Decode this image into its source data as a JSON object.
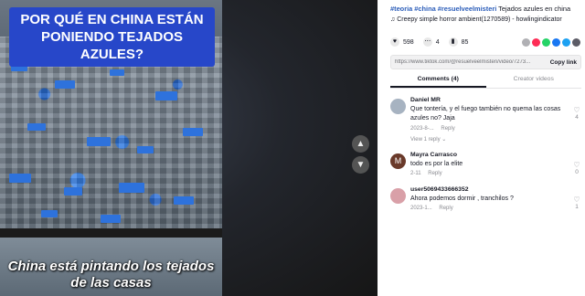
{
  "video": {
    "overlay_title": "POR QUÉ EN CHINA ESTÁN PONIENDO TEJADOS AZULES?",
    "caption": "China está pintando los tejados de las casas",
    "nav_up_icon": "chevron-up-icon",
    "nav_down_icon": "chevron-down-icon"
  },
  "post": {
    "hashtags": "#teoria #china #resuelveelmisteri",
    "description": " Tejados azules en china",
    "music_icon": "♫",
    "music": "Creepy simple horror ambient(1270589) - howlingindicator"
  },
  "stats": {
    "likes": "598",
    "comments": "4",
    "saves": "85"
  },
  "share": {
    "url": "https://www.tiktok.com/@resuelveelmisteri/video/7273...",
    "copy_label": "Copy link",
    "colors": [
      "#b0b0b4",
      "#fe2c55",
      "#25d366",
      "#1877f2",
      "#1da1f2",
      "#5c5c66"
    ]
  },
  "tabs": {
    "comments": "Comments (4)",
    "creator_videos": "Creator videos"
  },
  "comments": [
    {
      "author": "Daniel MR",
      "text": "Que tontería, y el fuego también no quema las cosas azules no? Jaja",
      "date": "2023-8-...",
      "reply": "Reply",
      "likes": "4",
      "view_replies": "View 1 reply ⌄",
      "avatar_color": "#a7b3c1"
    },
    {
      "author": "Mayra Carrasco",
      "text": "todo es por la elite",
      "date": "2-11",
      "reply": "Reply",
      "likes": "0",
      "avatar_color": "#6a3a2a"
    },
    {
      "author": "user5069433666352",
      "text": "Ahora podemos dormir , tranchilos ?",
      "date": "2023-1...",
      "reply": "Reply",
      "likes": "1",
      "avatar_color": "#d9a0a8"
    }
  ]
}
